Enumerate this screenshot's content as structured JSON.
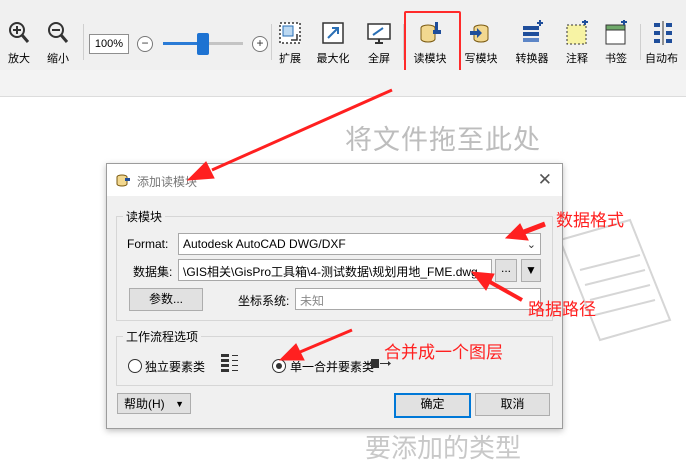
{
  "toolbar": {
    "zoom_in": "放大",
    "zoom_out": "缩小",
    "zoom_level": "100%",
    "zoom_minus": "−",
    "zoom_plus": "+",
    "zoom_slider_value": 0.5,
    "expand": "扩展",
    "maximize": "最大化",
    "fullscreen": "全屏",
    "reader": "读模块",
    "writer": "写模块",
    "transformer": "转换器",
    "annotation": "注释",
    "bookmark": "书签",
    "auto_layout": "自动布"
  },
  "canvas": {
    "drop_hint": "将文件拖至此处",
    "hint_bottom": "要添加的类型"
  },
  "dialog": {
    "title": "添加读模块",
    "close": "✕",
    "reader_group": "读模块",
    "format_label": "Format:",
    "format_value": "Autodesk AutoCAD DWG/DXF",
    "dataset_label": "数据集:",
    "dataset_value": "\\GIS相关\\GisPro工具箱\\4-测试数据\\规划用地_FME.dwg",
    "browse": "...",
    "params_button": "参数...",
    "coord_label": "坐标系统:",
    "coord_value": "未知",
    "workflow_group": "工作流程选项",
    "option_individual": "独立要素类",
    "option_merged": "单一合并要素类",
    "help_button": "帮助(H)",
    "ok_button": "确定",
    "cancel_button": "取消"
  },
  "annotations": {
    "format_note": "数据格式",
    "path_note": "路据路径",
    "merge_note": "合并成一个图层"
  },
  "colors": {
    "annotation": "#ff2020",
    "accent": "#0078d7"
  }
}
